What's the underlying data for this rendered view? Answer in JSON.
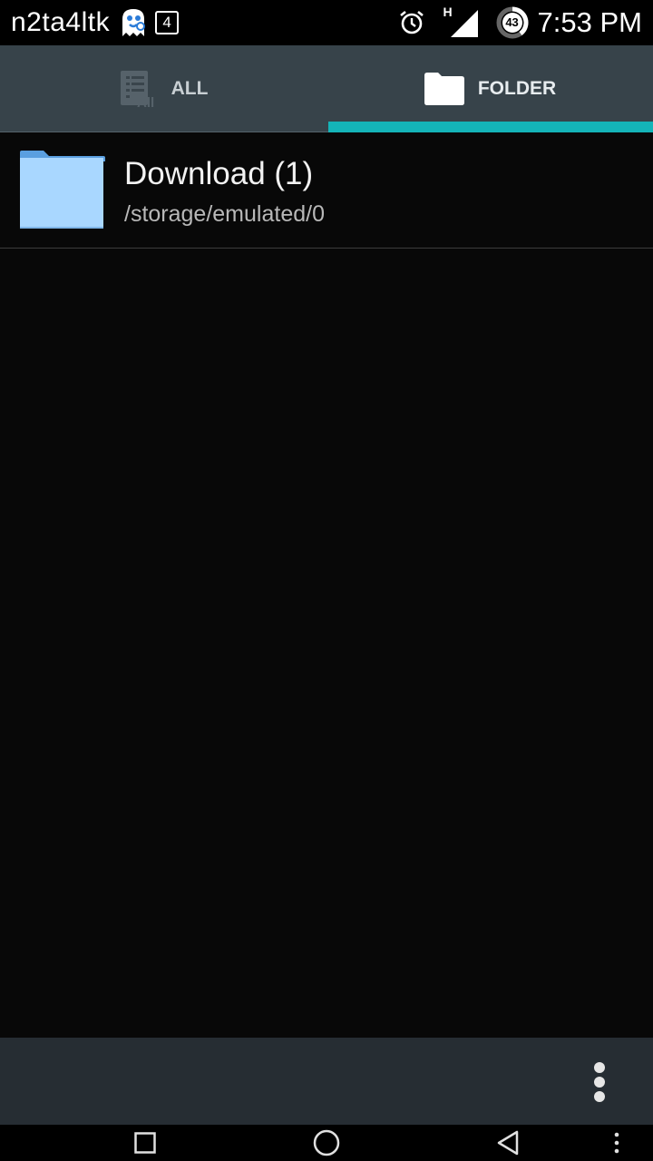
{
  "status_bar": {
    "carrier": "n2ta4ltk",
    "notification_count": "4",
    "battery_level": "43",
    "network_type": "H",
    "time": "7:53 PM"
  },
  "tabs": [
    {
      "label": "ALL",
      "icon": "list-all-icon",
      "selected": false
    },
    {
      "label": "FOLDER",
      "icon": "folder-icon",
      "selected": true
    }
  ],
  "folders": [
    {
      "name": "Download (1)",
      "path": "/storage/emulated/0"
    }
  ],
  "colors": {
    "accent": "#14b4b8",
    "tab_bar": "#37434a",
    "action_bar": "#262d33",
    "folder": "#a9d7ff"
  }
}
